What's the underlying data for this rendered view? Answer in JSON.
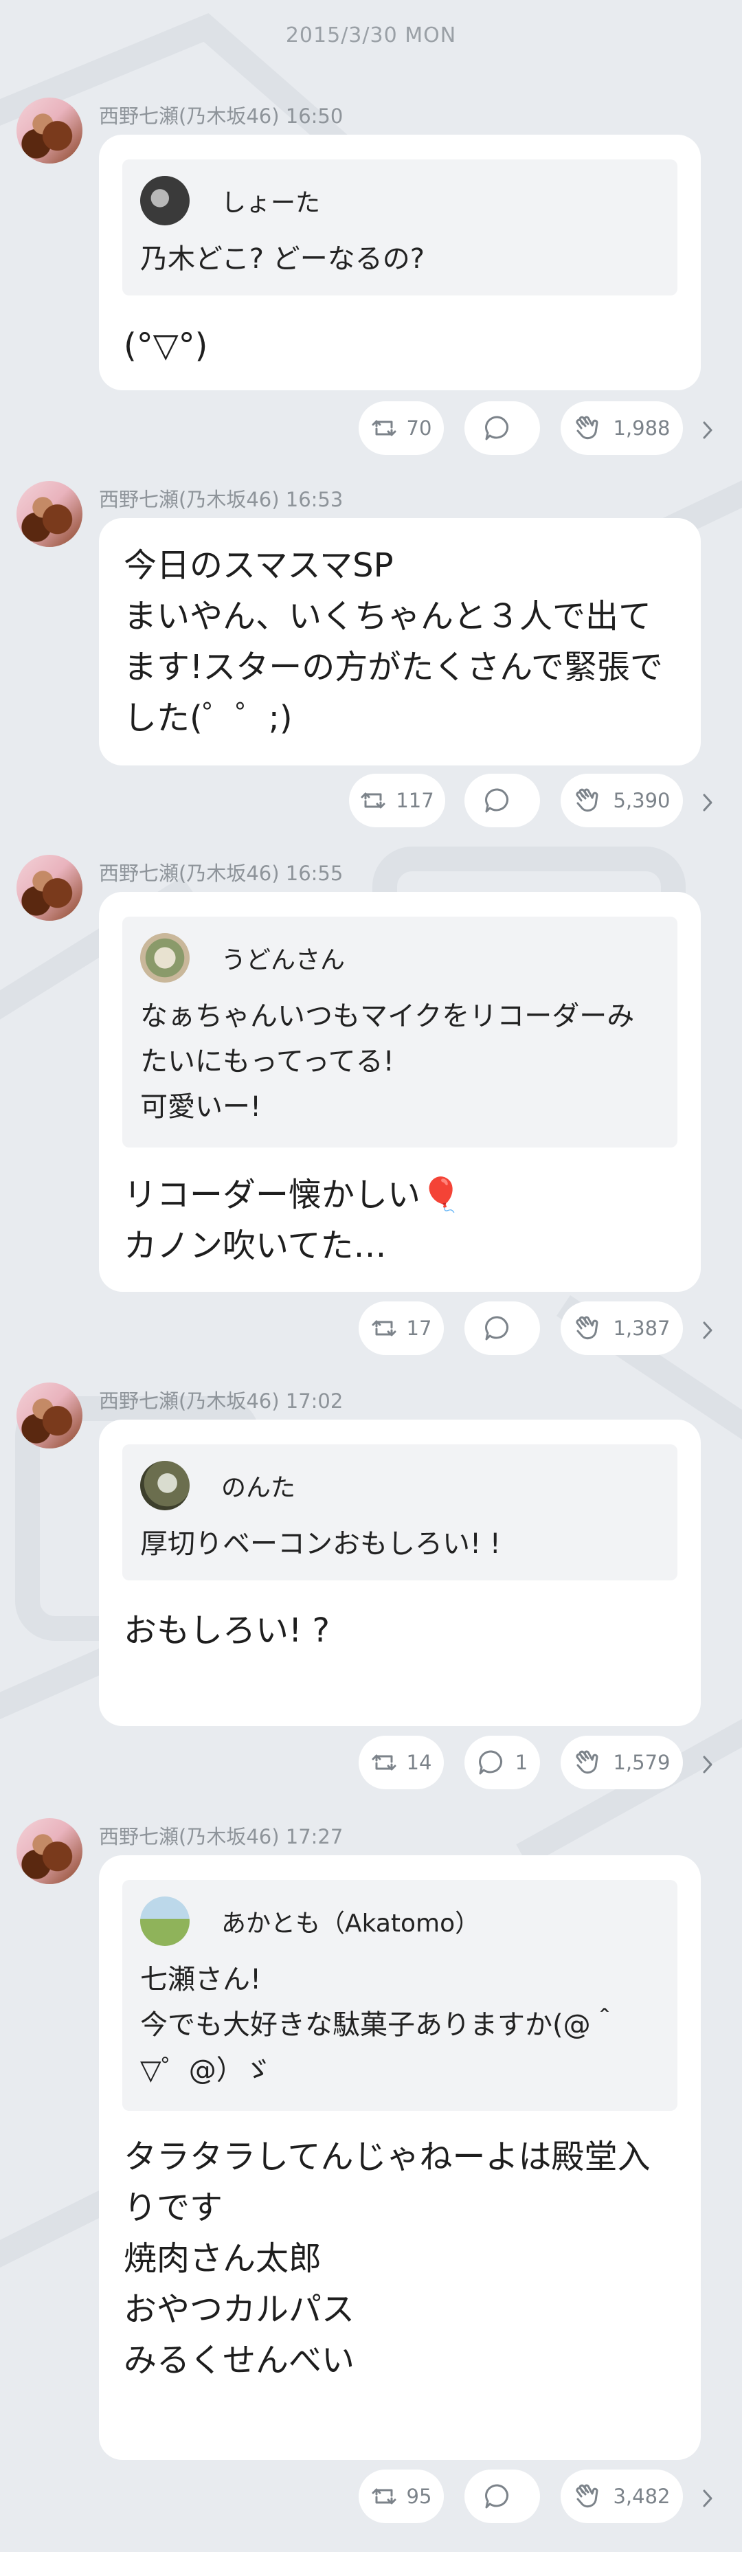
{
  "date_header": "2015/3/30 MON",
  "posts": [
    {
      "author": "西野七瀬(乃木坂46)",
      "time": "16:50",
      "quote": {
        "name": "しょーた",
        "text": "乃木どこ? どーなるの?"
      },
      "text": "(°▽°)",
      "retweets": "70",
      "replies": "",
      "claps": "1,988"
    },
    {
      "author": "西野七瀬(乃木坂46)",
      "time": "16:53",
      "quote": null,
      "text": "今日のスマスマSP\nまいやん、いくちゃんと３人で出て\nます!スターの方がたくさんで緊張で\nした(゜゜;)",
      "retweets": "117",
      "replies": "",
      "claps": "5,390"
    },
    {
      "author": "西野七瀬(乃木坂46)",
      "time": "16:55",
      "quote": {
        "name": "うどんさん",
        "text": "なぁちゃんいつもマイクをリコーダーみ\nたいにもってってる!\n可愛いー!"
      },
      "text": "リコーダー懐かしい🎈\nカノン吹いてた…",
      "retweets": "17",
      "replies": "",
      "claps": "1,387"
    },
    {
      "author": "西野七瀬(乃木坂46)",
      "time": "17:02",
      "quote": {
        "name": "のんた",
        "text": "厚切りベーコンおもしろい! !"
      },
      "text": "おもしろい! ?",
      "retweets": "14",
      "replies": "1",
      "claps": "1,579"
    },
    {
      "author": "西野七瀬(乃木坂46)",
      "time": "17:27",
      "quote": {
        "name": "あかとも（Akatomo）",
        "text": "七瀬さん!\n今でも大好きな駄菓子ありますか(@＾\n▽゜@）ゞ"
      },
      "text": "タラタラしてんじゃねーよは殿堂入\nりです\n焼肉さん太郎\nおやつカルパス\nみるくせんべい",
      "retweets": "95",
      "replies": "",
      "claps": "3,482"
    }
  ],
  "colors": {
    "background": "#e8ebef",
    "bubble": "#ffffff",
    "quote_bg": "#f2f3f5",
    "meta": "#8e949a"
  },
  "icons": [
    "retweet-icon",
    "comment-icon",
    "clap-icon",
    "chevron-right-icon"
  ]
}
